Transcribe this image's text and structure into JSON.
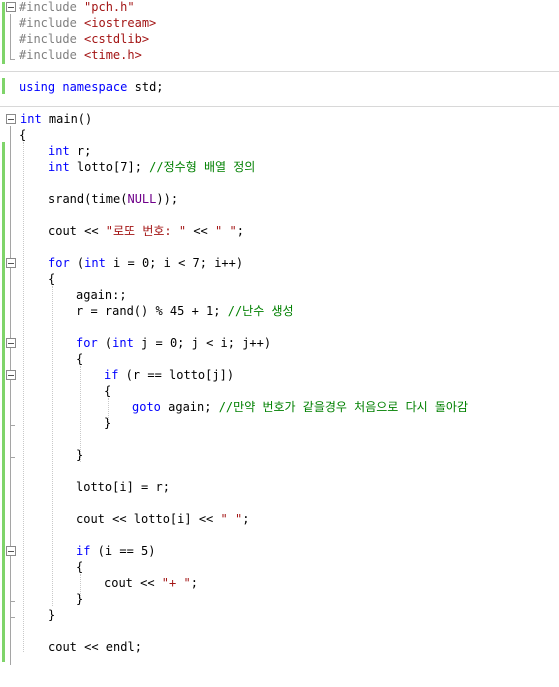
{
  "lines": {
    "l01": {
      "directive": "#include",
      "str": "\"pch.h\""
    },
    "l02": {
      "directive": "#include",
      "str": "<iostream>"
    },
    "l03": {
      "directive": "#include",
      "str": "<cstdlib>"
    },
    "l04": {
      "directive": "#include",
      "str": "<time.h>"
    },
    "l05": {
      "kw1": "using",
      "kw2": "namespace",
      "rest": " std;"
    },
    "l06": {
      "kw": "int",
      "rest": " main()"
    },
    "l07": {
      "text": "{"
    },
    "l08": {
      "kw": "int",
      "rest": " r;"
    },
    "l09": {
      "kw": "int",
      "rest": " lotto[7]; ",
      "comment": "//정수형 배열 정의"
    },
    "l10": {
      "pre": "srand(time(",
      "macro": "NULL",
      "post": "));"
    },
    "l11": {
      "pre": "cout << ",
      "str": "\"로또 번호: \"",
      "mid": " << ",
      "str2": "\" \"",
      "post": ";"
    },
    "l12": {
      "kw": "for",
      "pre": " (",
      "kw2": "int",
      "post": " i = 0; i < 7; i++)"
    },
    "l13": {
      "text": "{"
    },
    "l14": {
      "text": "again:;"
    },
    "l15": {
      "pre": "r = rand() % 45 + 1; ",
      "comment": "//난수 생성"
    },
    "l16": {
      "kw": "for",
      "pre": " (",
      "kw2": "int",
      "post": " j = 0; j < i; j++)"
    },
    "l17": {
      "text": "{"
    },
    "l18": {
      "kw": "if",
      "rest": " (r == lotto[j])"
    },
    "l19": {
      "text": "{"
    },
    "l20": {
      "kw": "goto",
      "rest": " again; ",
      "comment": "//만약 번호가 같을경우 처음으로 다시 돌아감"
    },
    "l21": {
      "text": "}"
    },
    "l22": {
      "text": "}"
    },
    "l23": {
      "text": "lotto[i] = r;"
    },
    "l24": {
      "pre": "cout << lotto[i] << ",
      "str": "\" \"",
      "post": ";"
    },
    "l25": {
      "kw": "if",
      "rest": " (i == 5)"
    },
    "l26": {
      "text": "{"
    },
    "l27": {
      "pre": "cout << ",
      "str": "\"+ \"",
      "post": ";"
    },
    "l28": {
      "text": "}"
    },
    "l29": {
      "text": "}"
    },
    "l30": {
      "pre": "cout << ",
      "rest": "endl;"
    }
  },
  "colors": {
    "keyword": "#0000ff",
    "preprocessor": "#808080",
    "string": "#a31515",
    "comment": "#008000",
    "macro": "#6f008a",
    "change_bar": "#7fd46a"
  }
}
